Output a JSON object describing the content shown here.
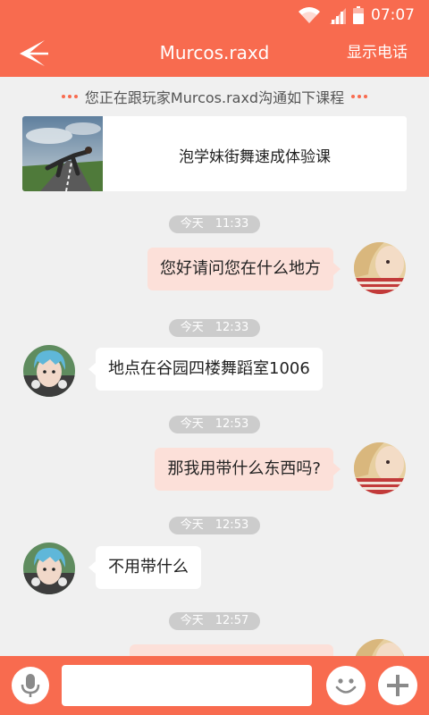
{
  "status": {
    "time": "07:07"
  },
  "header": {
    "title": "Murcos.raxd",
    "action_label": "显示电话"
  },
  "notice": {
    "text": "您正在跟玩家Murcos.raxd沟通如下课程"
  },
  "course": {
    "title": "泡学妹街舞速成体验课"
  },
  "messages": [
    {
      "time": "今天　11:33",
      "side": "out",
      "text": "您好请问您在什么地方"
    },
    {
      "time": "今天　12:33",
      "side": "in",
      "text": "地点在谷园四楼舞蹈室1006"
    },
    {
      "time": "今天　12:53",
      "side": "out",
      "text": "那我用带什么东西吗?"
    },
    {
      "time": "今天　12:53",
      "side": "in",
      "text": "不用带什么"
    },
    {
      "time": "今天　12:57",
      "side": "out",
      "text": ""
    }
  ],
  "composer": {
    "placeholder": "",
    "value": ""
  },
  "icons": {
    "back": "back-arrow-icon",
    "wifi": "wifi-icon",
    "signal": "signal-icon",
    "battery": "battery-icon",
    "mic": "microphone-icon",
    "emoji": "smiley-icon",
    "add": "plus-icon"
  },
  "colors": {
    "accent": "#f86b4f",
    "outgoing_bubble": "#fce0d9",
    "incoming_bubble": "#ffffff",
    "time_pill": "#cccccc",
    "background": "#f0f0f0"
  }
}
